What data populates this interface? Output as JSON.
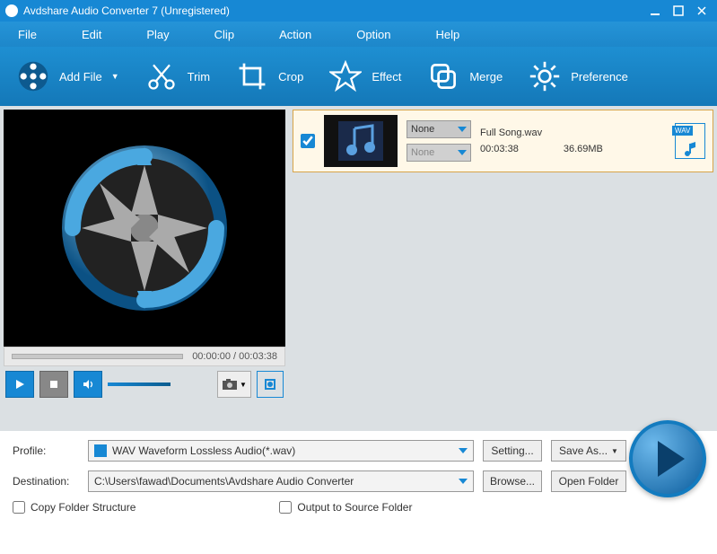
{
  "title": "Avdshare Audio Converter 7 (Unregistered)",
  "menu": {
    "file": "File",
    "edit": "Edit",
    "play": "Play",
    "clip": "Clip",
    "action": "Action",
    "option": "Option",
    "help": "Help"
  },
  "toolbar": {
    "add_file": "Add File",
    "trim": "Trim",
    "crop": "Crop",
    "effect": "Effect",
    "merge": "Merge",
    "preference": "Preference"
  },
  "player": {
    "time": "00:00:00 / 00:03:38"
  },
  "files": [
    {
      "name": "Full Song.wav",
      "duration": "00:03:38",
      "size": "36.69MB",
      "format_badge": "WAV",
      "dd1": "None",
      "dd2": "None",
      "checked": true
    }
  ],
  "profile": {
    "label": "Profile:",
    "value": "WAV Waveform Lossless Audio(*.wav)",
    "setting": "Setting...",
    "save_as": "Save As..."
  },
  "destination": {
    "label": "Destination:",
    "value": "C:\\Users\\fawad\\Documents\\Avdshare Audio Converter",
    "browse": "Browse...",
    "open_folder": "Open Folder"
  },
  "options": {
    "copy_folder": "Copy Folder Structure",
    "output_source": "Output to Source Folder"
  }
}
